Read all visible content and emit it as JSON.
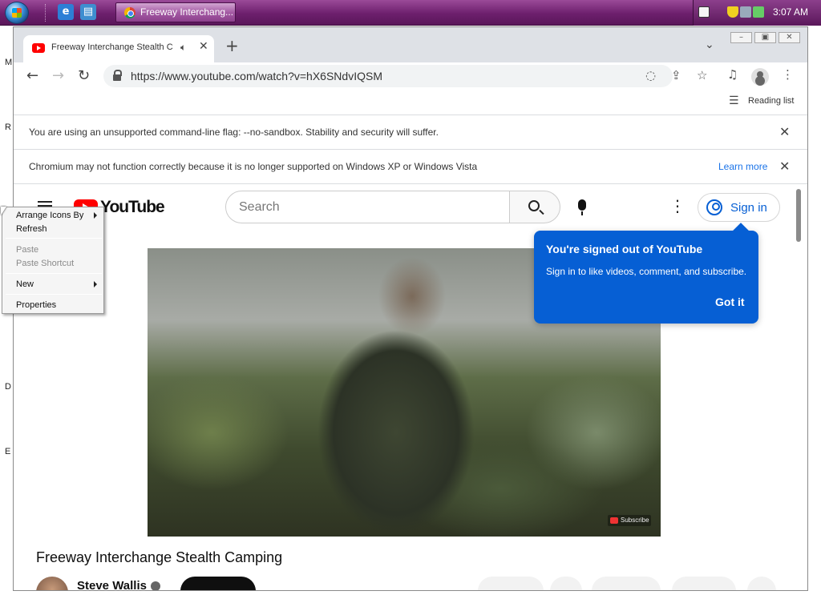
{
  "taskbar": {
    "active_task": "Freeway Interchang...",
    "clock": "3:07 AM"
  },
  "desktop": {
    "letters": [
      "M",
      "R",
      "D",
      "E"
    ]
  },
  "browser": {
    "tab_title": "Freeway Interchange Stealth Ca",
    "new_tab_symbol": "+",
    "url": "https://www.youtube.com/watch?v=hX6SNdvIQSM",
    "reading_list": "Reading list",
    "infobar_1": "You are using an unsupported command-line flag: --no-sandbox. Stability and security will suffer.",
    "infobar_2": "Chromium may not function correctly because it is no longer supported on Windows XP or Windows Vista",
    "learn_more": "Learn more"
  },
  "youtube": {
    "logo_text": "YouTube",
    "search_placeholder": "Search",
    "sign_in": "Sign in",
    "tooltip": {
      "title": "You're signed out of YouTube",
      "body": "Sign in to like videos, comment, and subscribe.",
      "button": "Got it"
    },
    "video_watermark": "Subscribe",
    "video_title": "Freeway Interchange Stealth Camping",
    "channel_name": "Steve Wallis"
  },
  "context_menu": {
    "items": [
      {
        "label": "Arrange Icons By",
        "enabled": true,
        "submenu": true
      },
      {
        "label": "Refresh",
        "enabled": true,
        "submenu": false
      },
      {
        "label": "Paste",
        "enabled": false,
        "submenu": false
      },
      {
        "label": "Paste Shortcut",
        "enabled": false,
        "submenu": false
      },
      {
        "label": "New",
        "enabled": true,
        "submenu": true
      },
      {
        "label": "Properties",
        "enabled": true,
        "submenu": false
      }
    ]
  },
  "icons": [
    "start-orb-icon",
    "ie-icon",
    "folder-icon",
    "chrome-icon",
    "keyboard-icon",
    "shield-icon",
    "network-icon",
    "volume-icon",
    "youtube-favicon",
    "audio-icon",
    "close-icon",
    "back-icon",
    "forward-icon",
    "reload-icon",
    "lock-icon",
    "eye-off-icon",
    "share-icon",
    "star-icon",
    "media-icon",
    "profile-icon",
    "menu-icon",
    "reading-list-icon",
    "hamburger-icon",
    "search-icon",
    "mic-icon",
    "more-icon",
    "user-icon",
    "verified-icon"
  ],
  "colors": {
    "taskbar": "#6d1f6d",
    "youtube_red": "#ff0000",
    "tooltip_blue": "#065fd4",
    "link_blue": "#1a73e8"
  }
}
